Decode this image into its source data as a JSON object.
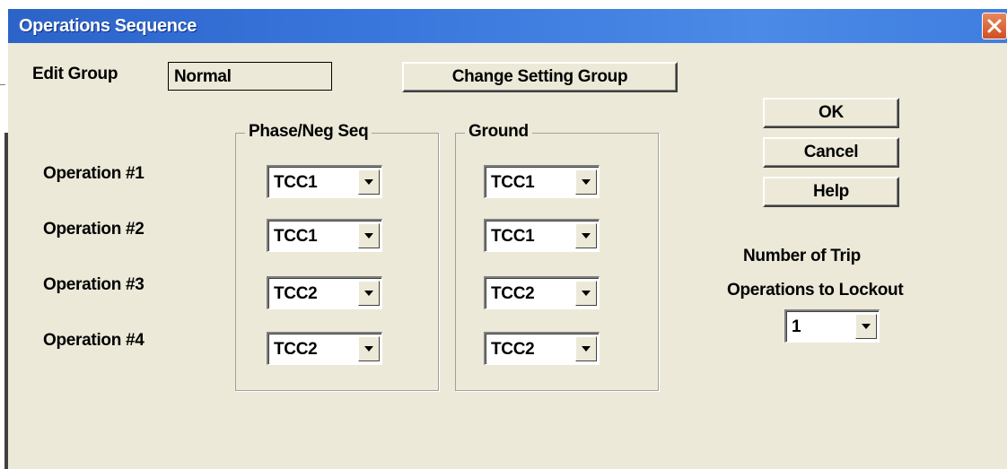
{
  "window": {
    "title": "Operations Sequence"
  },
  "edit_group": {
    "label": "Edit Group",
    "value": "Normal"
  },
  "buttons": {
    "change_group": "Change Setting Group",
    "ok": "OK",
    "cancel": "Cancel",
    "help": "Help"
  },
  "groups": {
    "phase": "Phase/Neg Seq",
    "ground": "Ground"
  },
  "operations": [
    {
      "label": "Operation #1",
      "phase": "TCC1",
      "ground": "TCC1"
    },
    {
      "label": "Operation #2",
      "phase": "TCC1",
      "ground": "TCC1"
    },
    {
      "label": "Operation #3",
      "phase": "TCC2",
      "ground": "TCC2"
    },
    {
      "label": "Operation #4",
      "phase": "TCC2",
      "ground": "TCC2"
    }
  ],
  "lockout": {
    "line1": "Number of Trip",
    "line2": "Operations to Lockout",
    "value": "1"
  },
  "icons": {
    "close": "close-icon",
    "dropdown": "chevron-down-icon"
  },
  "colors": {
    "titlebar": "#2c63c9",
    "dialog_bg": "#ece9d8",
    "close_button": "#d24e22"
  }
}
